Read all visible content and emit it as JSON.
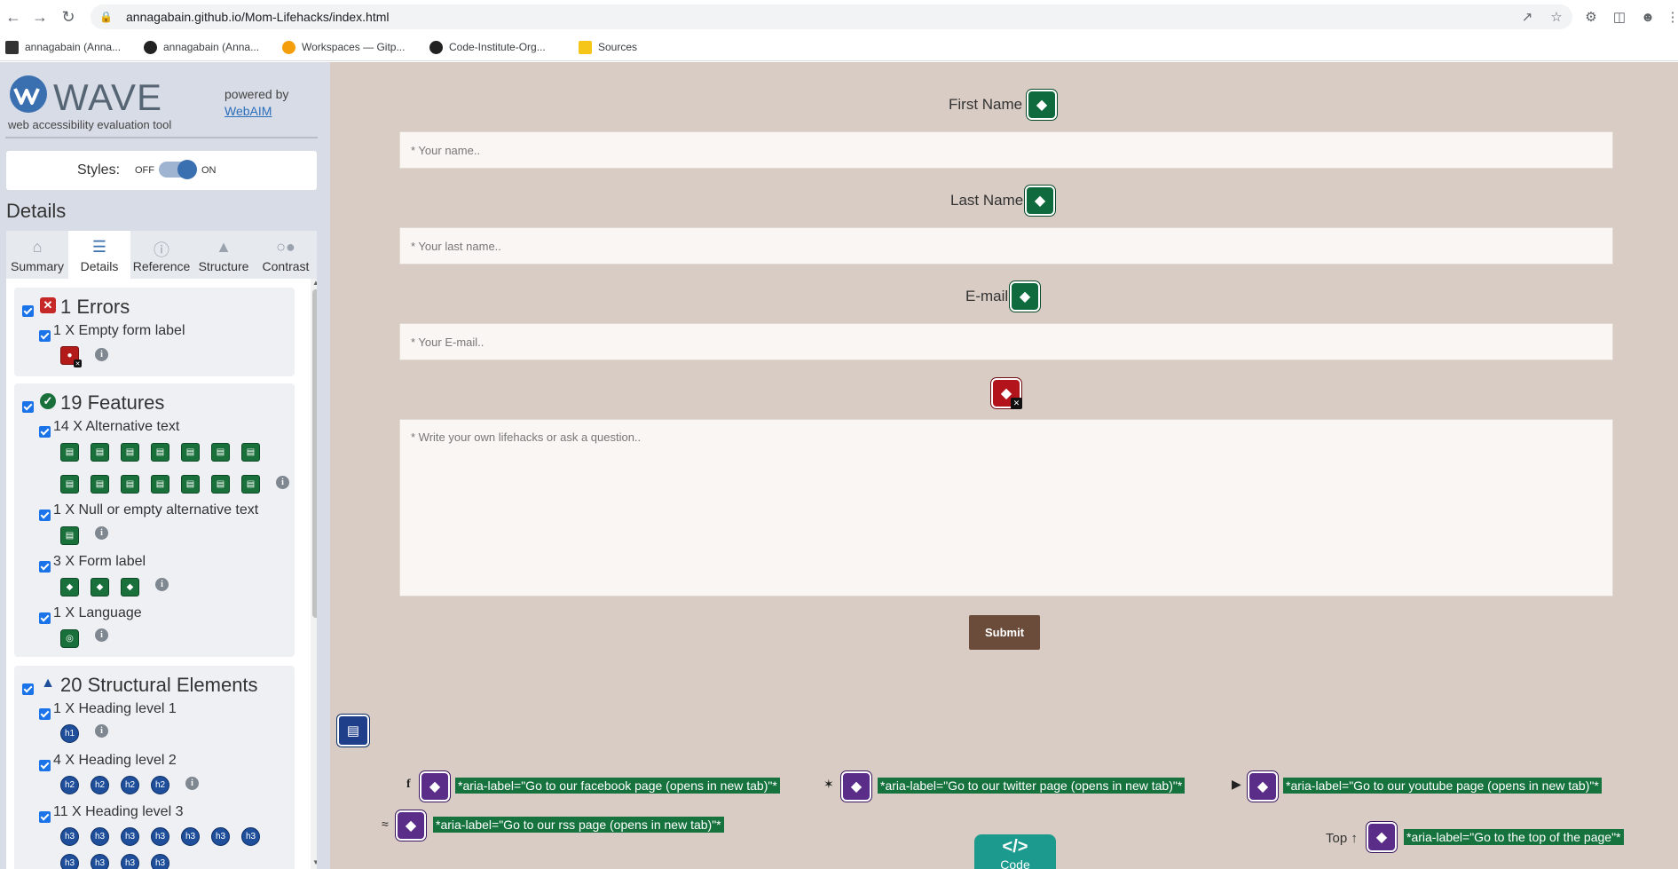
{
  "browser": {
    "url": "annagabain.github.io/Mom-Lifehacks/index.html",
    "bookmarks": [
      {
        "label": "annagabain (Anna...",
        "icon": "cookie-icon"
      },
      {
        "label": "annagabain (Anna...",
        "icon": "github-icon"
      },
      {
        "label": "Workspaces — Gitp...",
        "icon": "gitpod-icon"
      },
      {
        "label": "Code-Institute-Org...",
        "icon": "github-icon"
      },
      {
        "label": "Sources",
        "icon": "folder-icon"
      }
    ]
  },
  "wave": {
    "logo_word": "WAVE",
    "subtitle": "web accessibility evaluation tool",
    "powered_by": "powered by",
    "webaim": "WebAIM",
    "styles_label": "Styles:",
    "styles_off": "OFF",
    "styles_on": "ON",
    "styles_state": "on",
    "details_title": "Details",
    "tabs": [
      {
        "label": "Summary",
        "icon": "home-icon",
        "active": false
      },
      {
        "label": "Details",
        "icon": "list-icon",
        "active": true
      },
      {
        "label": "Reference",
        "icon": "info-icon",
        "active": false
      },
      {
        "label": "Structure",
        "icon": "hierarchy-icon",
        "active": false
      },
      {
        "label": "Contrast",
        "icon": "contrast-icon",
        "active": false
      }
    ],
    "errors": {
      "heading": "1 Errors",
      "items": [
        {
          "label": "1 X Empty form label",
          "count": 1,
          "icon": "empty-label-icon"
        }
      ]
    },
    "features": {
      "heading": "19 Features",
      "items": [
        {
          "label": "14 X Alternative text",
          "count": 14,
          "icon": "alt-text-icon"
        },
        {
          "label": "1 X Null or empty alternative text",
          "count": 1,
          "icon": "null-alt-icon"
        },
        {
          "label": "3 X Form label",
          "count": 3,
          "icon": "form-label-icon"
        },
        {
          "label": "1 X Language",
          "count": 1,
          "icon": "language-icon"
        }
      ]
    },
    "structure": {
      "heading": "20 Structural Elements",
      "items": [
        {
          "label": "1 X Heading level 1",
          "count": 1,
          "badge": "h1"
        },
        {
          "label": "4 X Heading level 2",
          "count": 4,
          "badge": "h2"
        },
        {
          "label": "11 X Heading level 3",
          "count": 11,
          "badge": "h3"
        }
      ]
    }
  },
  "page": {
    "form": {
      "first_name_label": "First Name",
      "first_name_placeholder": "* Your name..",
      "last_name_label": "Last Name",
      "last_name_placeholder": "* Your last name..",
      "email_label": "E-mail",
      "email_placeholder": "* Your E-mail..",
      "message_placeholder": "* Write your own lifehacks or ask a question..",
      "submit_label": "Submit"
    },
    "social": {
      "facebook_aria": "*aria-label=\"Go to our facebook page (opens in new tab)\"*",
      "twitter_aria": "*aria-label=\"Go to our twitter page (opens in new tab)\"*",
      "youtube_aria": "*aria-label=\"Go to our youtube page (opens in new tab)\"*",
      "rss_aria": "*aria-label=\"Go to our rss page (opens in new tab)\"*"
    },
    "top_link": "Top",
    "top_aria": "*aria-label=\"Go to the top of the page\"*",
    "code_tab_symbol": "</>",
    "code_tab_label": "Code"
  },
  "colors": {
    "page_bg": "#d8ccc4",
    "sidebar_bg": "#d8dce6",
    "feature_green": "#19703b",
    "error_red": "#b31b1b",
    "aria_purple": "#5a2d88",
    "heading_blue": "#1f4f9a",
    "submit_brown": "#6b4c3b",
    "code_teal": "#1d9a8e"
  }
}
